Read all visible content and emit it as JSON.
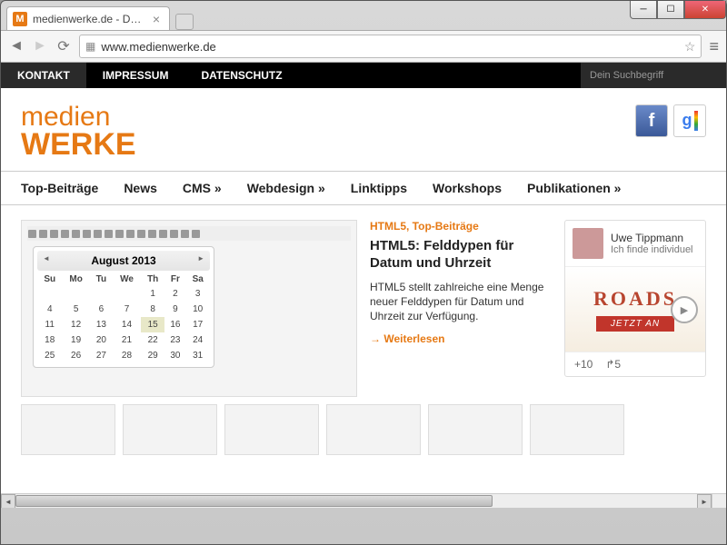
{
  "window": {
    "tab_title": "medienwerke.de - Daniel ",
    "favicon_letter": "M"
  },
  "browser": {
    "url": "www.medienwerke.de"
  },
  "topnav": {
    "items": [
      "KONTAKT",
      "IMPRESSUM",
      "DATENSCHUTZ"
    ],
    "search_placeholder": "Dein Suchbegriff"
  },
  "logo": {
    "line1": "medien",
    "line2": "WERKE"
  },
  "mainnav": {
    "items": [
      "Top-Beiträge",
      "News",
      "CMS »",
      "Webdesign »",
      "Linktipps",
      "Workshops",
      "Publikationen »"
    ]
  },
  "feature": {
    "calendar": {
      "title": "August 2013",
      "days": [
        "Su",
        "Mo",
        "Tu",
        "We",
        "Th",
        "Fr",
        "Sa"
      ],
      "rows": [
        [
          "",
          "",
          "",
          "",
          "1",
          "2",
          "3"
        ],
        [
          "4",
          "5",
          "6",
          "7",
          "8",
          "9",
          "10"
        ],
        [
          "11",
          "12",
          "13",
          "14",
          "15",
          "16",
          "17"
        ],
        [
          "18",
          "19",
          "20",
          "21",
          "22",
          "23",
          "24"
        ],
        [
          "25",
          "26",
          "27",
          "28",
          "29",
          "30",
          "31"
        ]
      ],
      "highlight": "15"
    },
    "categories": [
      "HTML5",
      "Top-Beiträge"
    ],
    "title": "HTML5: Felddypen für Datum und Uhrzeit",
    "excerpt": "HTML5 stellt zahlreiche eine Menge neuer Felddypen für Datum und Uhrzeit zur Verfügung.",
    "readmore": "Weiterlesen"
  },
  "sidebar": {
    "author": "Uwe Tippmann",
    "subtitle": "Ich finde individuel",
    "promo_text": "ROADS",
    "promo_sub": "JETZT AN",
    "plus_count": "+10",
    "share_count": "5"
  }
}
